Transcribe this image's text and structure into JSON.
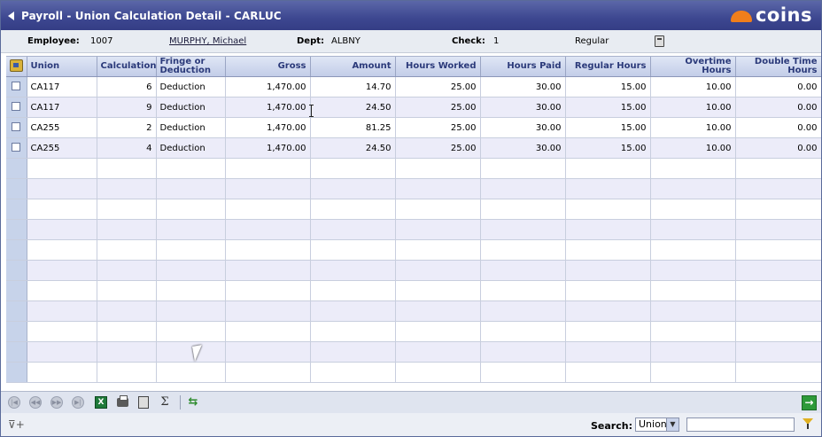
{
  "window": {
    "title": "Payroll - Union Calculation Detail - CARLUC",
    "brand": "coins",
    "brand_color": "#f07e1b"
  },
  "info": {
    "employee_label": "Employee:",
    "employee_id": "1007",
    "employee_name": "MURPHY, Michael",
    "dept_label": "Dept:",
    "dept_value": "ALBNY",
    "check_label": "Check:",
    "check_value": "1",
    "check_type": "Regular"
  },
  "grid": {
    "columns": [
      "Union",
      "Calculation",
      "Fringe or Deduction",
      "Gross",
      "Amount",
      "Hours Worked",
      "Hours Paid",
      "Regular Hours",
      "Overtime Hours",
      "Double Time Hours"
    ],
    "rows": [
      [
        "CA117",
        "6",
        "Deduction",
        "1,470.00",
        "14.70",
        "25.00",
        "30.00",
        "15.00",
        "10.00",
        "0.00"
      ],
      [
        "CA117",
        "9",
        "Deduction",
        "1,470.00",
        "24.50",
        "25.00",
        "30.00",
        "15.00",
        "10.00",
        "0.00"
      ],
      [
        "CA255",
        "2",
        "Deduction",
        "1,470.00",
        "81.25",
        "25.00",
        "30.00",
        "15.00",
        "10.00",
        "0.00"
      ],
      [
        "CA255",
        "4",
        "Deduction",
        "1,470.00",
        "24.50",
        "25.00",
        "30.00",
        "15.00",
        "10.00",
        "0.00"
      ]
    ],
    "empty_rows": 11
  },
  "toolbar": {
    "sigma": "Σ",
    "excel": "X"
  },
  "search": {
    "label": "Search:",
    "field_value": "Union",
    "input_value": ""
  }
}
